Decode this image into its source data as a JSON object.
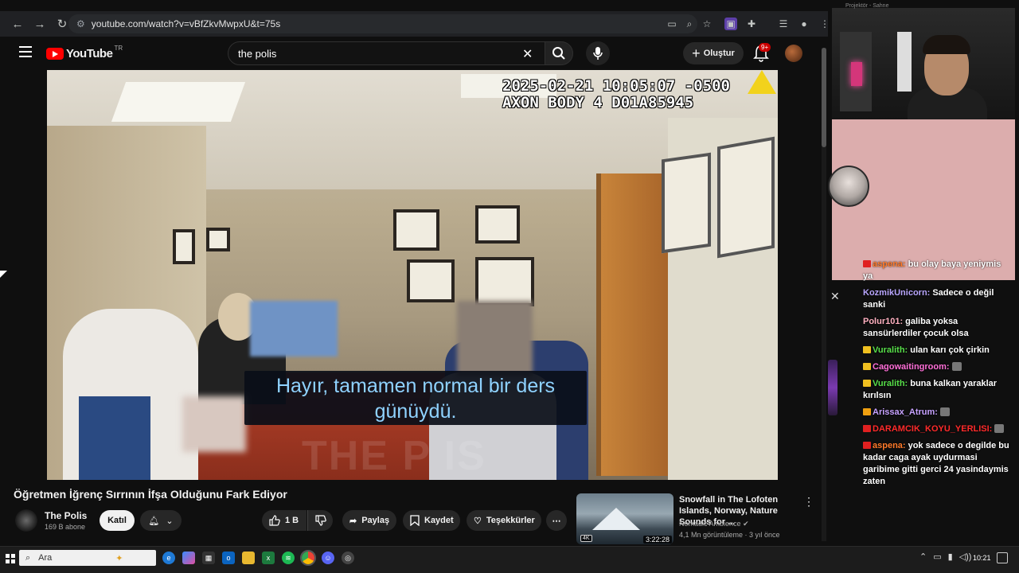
{
  "browser": {
    "back": "←",
    "forward": "→",
    "reload": "↻",
    "url": "youtube.com/watch?v=vBfZkvMwpxU&t=75s"
  },
  "header": {
    "logo_text": "YouTube",
    "region": "TR",
    "search_value": "the polis",
    "create_label": "Oluştur",
    "notification_count": "9+"
  },
  "video": {
    "stamp": "2025-02-21 10:05:07 -0500\nAXON BODY 4 D01A85945",
    "subtitle": "Hayır, tamamen normal bir ders günüydü.",
    "watermark": "THE P  IS",
    "title": "Öğretmen İğrenç Sırrının İfşa Olduğunu Fark Ediyor"
  },
  "channel": {
    "name": "The Polis",
    "subscribers": "169 B abone",
    "join_label": "Katıl"
  },
  "actions": {
    "likes": "1 B",
    "share_label": "Paylaş",
    "save_label": "Kaydet",
    "thanks_label": "Teşekkürler"
  },
  "recommended": {
    "title": "Snowfall in The Lofoten Islands, Norway, Nature Sounds for ...",
    "channel": "Nomadic Ambience",
    "meta": "4,1 Mn görüntüleme · 3 yıl önce",
    "duration": "3:22:28",
    "quality": "4K"
  },
  "stream": {
    "webcam_title": "Projektör - Sahne"
  },
  "chat": [
    {
      "user": "aspena:",
      "text": "bu olay baya yeniymis ya",
      "color": "#ff7a2a",
      "badge": "#e02020",
      "emote": false
    },
    {
      "user": "KozmikUnicorn:",
      "text": "Sadece o değil sanki",
      "color": "#b9a6ff",
      "badge": "",
      "emote": false
    },
    {
      "user": "Polur101:",
      "text": "galiba yoksa sansürlerdiler çocuk olsa",
      "color": "#ffb0c0",
      "badge": "",
      "emote": false
    },
    {
      "user": "Vuralith:",
      "text": "ulan karı çok çirkin",
      "color": "#58e04a",
      "badge": "#f0c020",
      "emote": false
    },
    {
      "user": "Cagowaitingroom:",
      "text": "",
      "color": "#ff6fd8",
      "badge": "#f0c020",
      "emote": true
    },
    {
      "user": "Vuralith:",
      "text": "buna kalkan yaraklar kırılsın",
      "color": "#58e04a",
      "badge": "#f0c020",
      "emote": false
    },
    {
      "user": "Arissax_Atrum:",
      "text": "",
      "color": "#c7a2ff",
      "badge": "#f0a010",
      "emote": true
    },
    {
      "user": "DARAMCIK_KOYU_YERLISI:",
      "text": "",
      "color": "#ff2b2b",
      "badge": "#e02020",
      "emote": true
    },
    {
      "user": "aspena:",
      "text": "yok sadece o degilde bu kadar caga ayak uydurmasi garibime gitti gerci 24 yasindaymis zaten",
      "color": "#ff7a2a",
      "badge": "#e02020",
      "emote": false
    }
  ],
  "taskbar": {
    "search_placeholder": "Ara",
    "time": "10:21"
  }
}
